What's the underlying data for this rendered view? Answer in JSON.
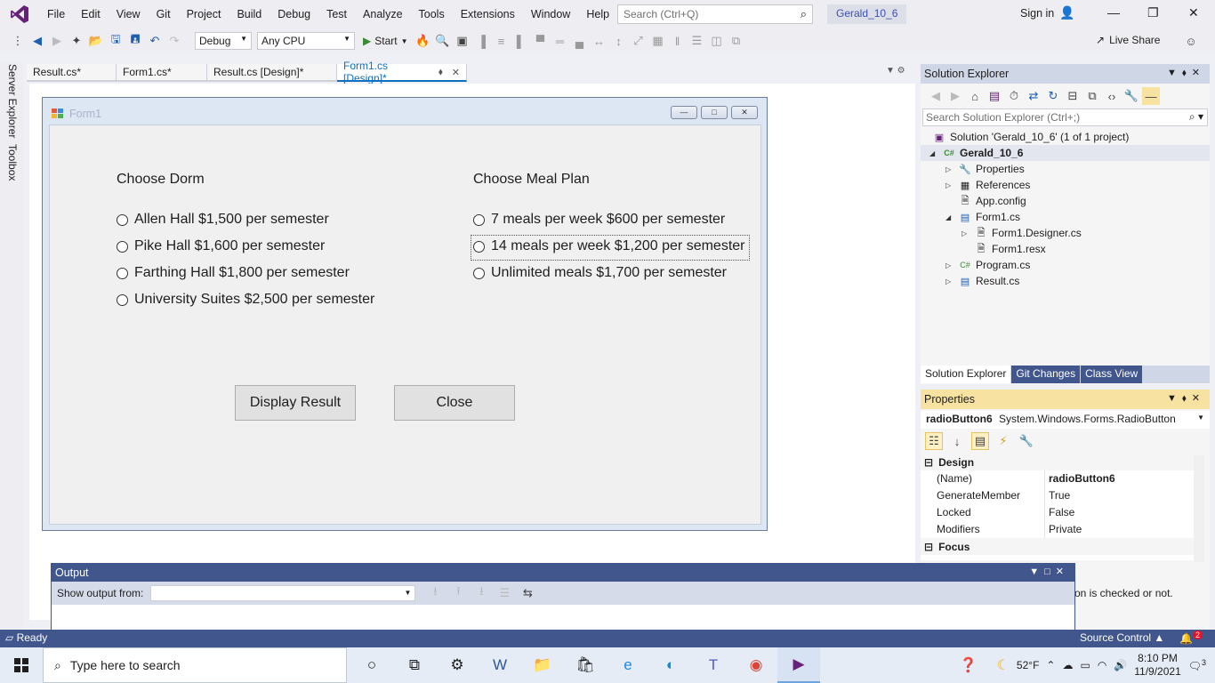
{
  "menubar": {
    "items": [
      "File",
      "Edit",
      "View",
      "Git",
      "Project",
      "Build",
      "Debug",
      "Test",
      "Analyze",
      "Tools",
      "Extensions",
      "Window",
      "Help"
    ],
    "search_placeholder": "Search (Ctrl+Q)",
    "solution_name": "Gerald_10_6",
    "sign_in": "Sign in"
  },
  "toolbar": {
    "config": "Debug",
    "platform": "Any CPU",
    "start_label": "Start",
    "live_share": "Live Share"
  },
  "left_tabs": [
    "Server Explorer",
    "Toolbox"
  ],
  "doc_tabs": [
    {
      "label": "Result.cs*"
    },
    {
      "label": "Form1.cs*"
    },
    {
      "label": "Result.cs [Design]*"
    },
    {
      "label": "Form1.cs [Design]*"
    }
  ],
  "form": {
    "title": "Form1",
    "dorm_label": "Choose Dorm",
    "meal_label": "Choose Meal Plan",
    "dorms": [
      "Allen Hall $1,500 per semester",
      "Pike Hall $1,600 per semester",
      "Farthing Hall $1,800 per semester",
      "University Suites $2,500 per semester"
    ],
    "meals": [
      "7 meals per week $600 per semester",
      "14 meals per week $1,200 per semester",
      "Unlimited meals $1,700 per semester"
    ],
    "display_button": "Display Result",
    "close_button": "Close"
  },
  "solution_explorer": {
    "title": "Solution Explorer",
    "search_placeholder": "Search Solution Explorer (Ctrl+;)",
    "tree": {
      "solution": "Solution 'Gerald_10_6' (1 of 1 project)",
      "project": "Gerald_10_6",
      "properties": "Properties",
      "references": "References",
      "app_config": "App.config",
      "form1": "Form1.cs",
      "form1_designer": "Form1.Designer.cs",
      "form1_resx": "Form1.resx",
      "program": "Program.cs",
      "result": "Result.cs"
    },
    "bottom_tabs": [
      "Solution Explorer",
      "Git Changes",
      "Class View"
    ]
  },
  "properties": {
    "title": "Properties",
    "object_name": "radioButton6",
    "object_type": "System.Windows.Forms.RadioButton",
    "cat_design": "Design",
    "cat_focus": "Focus",
    "rows": [
      {
        "k": "(Name)",
        "v": "radioButton6"
      },
      {
        "k": "GenerateMember",
        "v": "True"
      },
      {
        "k": "Locked",
        "v": "False"
      },
      {
        "k": "Modifiers",
        "v": "Private"
      }
    ],
    "description": "on is checked or not."
  },
  "output": {
    "title": "Output",
    "show_from": "Show output from:"
  },
  "status": {
    "ready": "Ready",
    "source_control": "Source Control",
    "notifications": "2"
  },
  "taskbar": {
    "search_placeholder": "Type here to search",
    "weather": "52°F",
    "time": "8:10 PM",
    "date": "11/9/2021",
    "notification_count": "3"
  },
  "colors": {
    "vs_purple": "#68217a",
    "accent_blue": "#40568d",
    "active_tab": "#0e70c0"
  }
}
